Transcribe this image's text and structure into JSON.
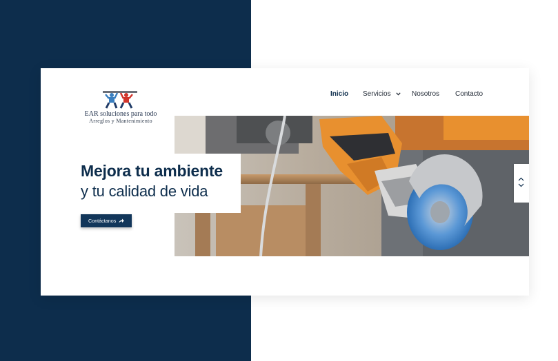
{
  "brand": {
    "name": "EAR soluciones para todo",
    "tagline": "Arreglos y Mantenimiento"
  },
  "nav": {
    "items": [
      {
        "label": "Inicio",
        "active": true
      },
      {
        "label": "Servicios",
        "active": false,
        "has_dropdown": true
      },
      {
        "label": "Nosotros",
        "active": false
      },
      {
        "label": "Contacto",
        "active": false
      }
    ]
  },
  "hero": {
    "headline_bold": "Mejora tu ambiente",
    "headline_regular": "y tu calidad de vida",
    "cta_label": "Contáctanos",
    "image_subject": "worker with angle grinder and work gloves"
  },
  "icons": {
    "logo": "two-workers-logo-icon",
    "dropdown": "chevron-down-icon",
    "cta": "share-arrow-icon",
    "slider_prev": "chevron-up-icon",
    "slider_next": "chevron-down-icon"
  },
  "colors": {
    "navy": "#0d2d4c",
    "accent_orange": "#e8902f",
    "background": "#ffffff"
  }
}
